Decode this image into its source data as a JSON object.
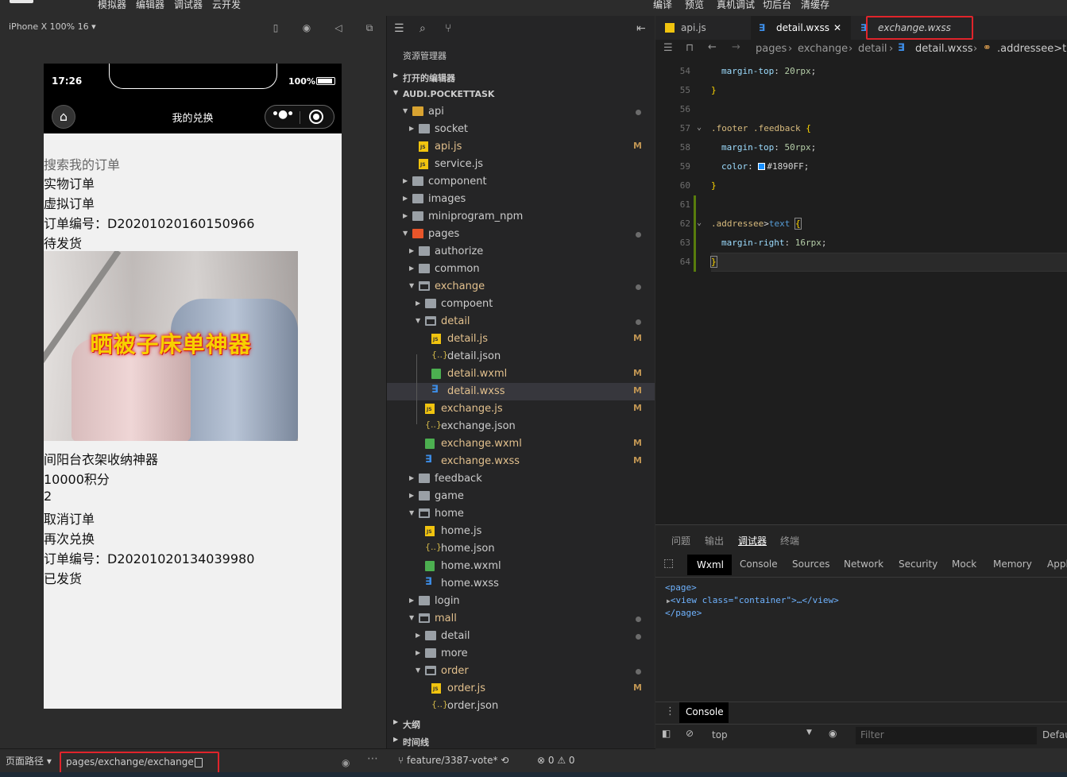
{
  "menu": {
    "items": [
      "模拟器",
      "编辑器",
      "调试器",
      "云开发"
    ],
    "right_items": [
      "编译",
      "预览",
      "真机调试",
      "切后台",
      "清缓存"
    ]
  },
  "simulator": {
    "device_label": "iPhone X 100% 16 ▾",
    "status_time": "17:26",
    "battery": "100%",
    "nav_title": "我的兑换",
    "content": {
      "search": "搜索我的订单",
      "tab_physical": "实物订单",
      "tab_virtual": "虚拟订单",
      "order1_no": "订单编号：D20201020160150966",
      "order1_status": "待发货",
      "product_image_text": "晒被子床单神器",
      "product_name": "间阳台衣架收纳神器",
      "points": "10000积分",
      "quantity": " 2",
      "cancel": "取消订单",
      "redeem_again": "再次兑换",
      "order2_no": "订单编号：D20201020134039980",
      "order2_status": "已发货"
    },
    "page_path_label": "页面路径 ▾",
    "page_path": "pages/exchange/exchange"
  },
  "explorer": {
    "title": "资源管理器",
    "open_editors": "打开的编辑器",
    "project": "AUDI.POCKETTASK",
    "outline": "大纲",
    "timeline": "时间线",
    "tree": [
      {
        "label": "api",
        "type": "folder-api",
        "open": true,
        "depth": 0,
        "badge": "dot"
      },
      {
        "label": "socket",
        "type": "folder",
        "open": false,
        "depth": 1,
        "badge": ""
      },
      {
        "label": "api.js",
        "type": "js",
        "depth": 1,
        "badge": "M",
        "modified": true
      },
      {
        "label": "service.js",
        "type": "js",
        "depth": 1,
        "badge": ""
      },
      {
        "label": "component",
        "type": "folder",
        "open": false,
        "depth": 0,
        "badge": ""
      },
      {
        "label": "images",
        "type": "folder",
        "open": false,
        "depth": 0,
        "badge": ""
      },
      {
        "label": "miniprogram_npm",
        "type": "folder",
        "open": false,
        "depth": 0,
        "badge": ""
      },
      {
        "label": "pages",
        "type": "folder-pages",
        "open": true,
        "depth": 0,
        "badge": "dot"
      },
      {
        "label": "authorize",
        "type": "folder",
        "open": false,
        "depth": 1,
        "badge": ""
      },
      {
        "label": "common",
        "type": "folder",
        "open": false,
        "depth": 1,
        "badge": ""
      },
      {
        "label": "exchange",
        "type": "folder",
        "open": true,
        "depth": 1,
        "badge": "dot",
        "modified": true
      },
      {
        "label": "compoent",
        "type": "folder",
        "open": false,
        "depth": 2,
        "badge": ""
      },
      {
        "label": "detail",
        "type": "folder",
        "open": true,
        "depth": 2,
        "badge": "dot",
        "modified": true
      },
      {
        "label": "detail.js",
        "type": "js",
        "depth": 3,
        "badge": "M",
        "modified": true
      },
      {
        "label": "detail.json",
        "type": "json",
        "depth": 3,
        "badge": ""
      },
      {
        "label": "detail.wxml",
        "type": "wxml",
        "depth": 3,
        "badge": "M",
        "modified": true
      },
      {
        "label": "detail.wxss",
        "type": "wxss",
        "depth": 3,
        "badge": "M",
        "modified": true,
        "selected": true
      },
      {
        "label": "exchange.js",
        "type": "js",
        "depth": 2,
        "badge": "M",
        "modified": true
      },
      {
        "label": "exchange.json",
        "type": "json",
        "depth": 2,
        "badge": ""
      },
      {
        "label": "exchange.wxml",
        "type": "wxml",
        "depth": 2,
        "badge": "M",
        "modified": true
      },
      {
        "label": "exchange.wxss",
        "type": "wxss",
        "depth": 2,
        "badge": "M",
        "modified": true
      },
      {
        "label": "feedback",
        "type": "folder",
        "open": false,
        "depth": 1,
        "badge": ""
      },
      {
        "label": "game",
        "type": "folder",
        "open": false,
        "depth": 1,
        "badge": ""
      },
      {
        "label": "home",
        "type": "folder",
        "open": true,
        "depth": 1,
        "badge": ""
      },
      {
        "label": "home.js",
        "type": "js",
        "depth": 2,
        "badge": ""
      },
      {
        "label": "home.json",
        "type": "json",
        "depth": 2,
        "badge": ""
      },
      {
        "label": "home.wxml",
        "type": "wxml",
        "depth": 2,
        "badge": ""
      },
      {
        "label": "home.wxss",
        "type": "wxss",
        "depth": 2,
        "badge": ""
      },
      {
        "label": "login",
        "type": "folder",
        "open": false,
        "depth": 1,
        "badge": ""
      },
      {
        "label": "mall",
        "type": "folder",
        "open": true,
        "depth": 1,
        "badge": "dot",
        "modified": true
      },
      {
        "label": "detail",
        "type": "folder",
        "open": false,
        "depth": 2,
        "badge": "dot"
      },
      {
        "label": "more",
        "type": "folder",
        "open": false,
        "depth": 2,
        "badge": ""
      },
      {
        "label": "order",
        "type": "folder",
        "open": true,
        "depth": 2,
        "badge": "dot",
        "modified": true
      },
      {
        "label": "order.js",
        "type": "js",
        "depth": 3,
        "badge": "M",
        "modified": true
      },
      {
        "label": "order.json",
        "type": "json",
        "depth": 3,
        "badge": ""
      }
    ],
    "branch": "feature/3387-vote*",
    "problems": "⊗ 0 ⚠ 0"
  },
  "editor": {
    "tabs": [
      {
        "label": "api.js"
      },
      {
        "label": "detail.wxss",
        "close": "✕"
      },
      {
        "label": "exchange.wxss"
      }
    ],
    "breadcrumb": [
      "pages",
      "exchange",
      "detail",
      "detail.wxss",
      ".addressee>te"
    ],
    "lines": [
      {
        "n": "54"
      },
      {
        "n": "55"
      },
      {
        "n": "56"
      },
      {
        "n": "57"
      },
      {
        "n": "58"
      },
      {
        "n": "59"
      },
      {
        "n": "60"
      },
      {
        "n": "61"
      },
      {
        "n": "62"
      },
      {
        "n": "63"
      },
      {
        "n": "64"
      }
    ],
    "code": {
      "l54_prop": "margin-top",
      "l54_val": "20",
      "l54_unit": "rpx",
      "l55": "}",
      "l57_sel": ".footer .feedback",
      "l57_br": "{",
      "l58_prop": "margin-top",
      "l58_val": "50",
      "l58_unit": "rpx",
      "l59_prop": "color",
      "l59_val": "#1890FF",
      "l60": "}",
      "l62_sel": ".addressee",
      "l62_op": ">",
      "l62_tag": "text",
      "l62_br": "{",
      "l63_prop": "margin-right",
      "l63_val": "16",
      "l63_unit": "rpx",
      "l64": "}"
    },
    "swatch_color": "#1890ff"
  },
  "devtools": {
    "top_tabs": [
      "问题",
      "输出",
      "调试器",
      "终端"
    ],
    "panels": [
      "Wxml",
      "Console",
      "Sources",
      "Network",
      "Security",
      "Mock",
      "Memory",
      "Appl"
    ],
    "tree": [
      "<page>",
      "<view class=\"container\">…</view>",
      "</page>"
    ],
    "console_tab": "Console",
    "context": "top",
    "filter_placeholder": "Filter",
    "levels": "Defau"
  }
}
